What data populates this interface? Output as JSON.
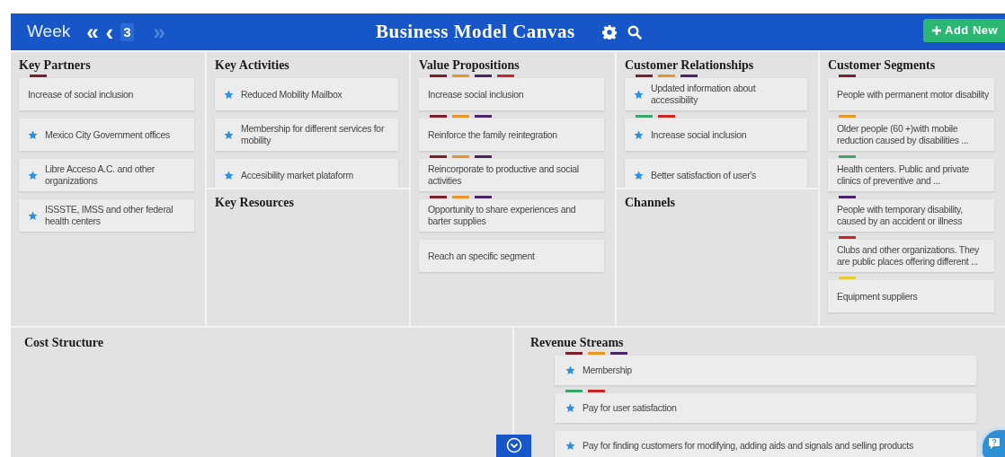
{
  "header": {
    "period_label": "Week",
    "nav": [
      {
        "kind": "first",
        "label": "«",
        "disabled": false
      },
      {
        "kind": "prev",
        "label": "‹",
        "disabled": false
      },
      {
        "kind": "current",
        "label": "3",
        "disabled": false
      },
      {
        "kind": "next",
        "label": "»",
        "disabled": true
      }
    ],
    "title": "Business Model Canvas",
    "add_button": "Add New"
  },
  "top_columns": [
    {
      "blocks": [
        {
          "title": "Key Partners",
          "cards": [
            {
              "text": "Increase of social inclusion",
              "starred": false,
              "tags": [
                {
                  "color": "#7a1f2b"
                }
              ]
            },
            {
              "text": "Mexico City Government offices",
              "starred": true
            },
            {
              "text": "Libre Acceso A.C. and other organizations",
              "starred": true
            },
            {
              "text": "ISSSTE, IMSS and other federal health centers",
              "starred": true
            }
          ]
        }
      ]
    },
    {
      "blocks": [
        {
          "title": "Key Activities",
          "cards": [
            {
              "text": "Reduced Mobility Mailbox",
              "starred": true
            },
            {
              "text": "Membership for different services for mobility",
              "starred": true
            },
            {
              "text": "Accesibility market plataform",
              "starred": true
            }
          ]
        },
        {
          "title": "Key Resources"
        }
      ]
    },
    {
      "blocks": [
        {
          "title": "Value Propositions",
          "cards": [
            {
              "text": "Increase social inclusion",
              "starred": false,
              "tags": [
                {
                  "color": "#7a1f2b"
                },
                {
                  "color": "#e8952a"
                },
                {
                  "color": "#4b2466"
                },
                {
                  "color": "#c62828"
                }
              ]
            },
            {
              "text": "Reinforce the family reintegration",
              "starred": false,
              "tags": [
                {
                  "color": "#7a1f2b"
                },
                {
                  "color": "#e8952a"
                },
                {
                  "color": "#4b2466"
                }
              ]
            },
            {
              "text": "Reincorporate to productive and social activities",
              "starred": false,
              "tags": [
                {
                  "color": "#7a1f2b"
                },
                {
                  "color": "#e8952a"
                },
                {
                  "color": "#4b2466"
                }
              ]
            },
            {
              "text": "Opportunity to share experiences and barter supplies",
              "starred": false,
              "tags": [
                {
                  "color": "#7a1f2b"
                },
                {
                  "color": "#e8952a"
                },
                {
                  "color": "#4b2466"
                }
              ]
            },
            {
              "text": "Reach an specific segment",
              "starred": false
            }
          ]
        }
      ]
    },
    {
      "blocks": [
        {
          "title": "Customer Relationships",
          "cards": [
            {
              "text": "Updated information about accessibility",
              "starred": true,
              "tags": [
                {
                  "color": "#7a1f2b"
                },
                {
                  "color": "#e8952a"
                },
                {
                  "color": "#4b2466"
                }
              ]
            },
            {
              "text": "Increase social inclusion",
              "starred": true,
              "tags": [
                {
                  "color": "#3aa66e"
                },
                {
                  "color": "#c62828"
                }
              ]
            },
            {
              "text": "Better satisfaction of user's",
              "starred": true
            }
          ]
        },
        {
          "title": "Channels"
        }
      ]
    },
    {
      "blocks": [
        {
          "title": "Customer Segments",
          "cards": [
            {
              "text": "People with permanent motor disability",
              "starred": false,
              "tags": [
                {
                  "color": "#7a1f2b"
                }
              ]
            },
            {
              "text": "Older people (60 +)with mobile reduction caused by disabilities ...",
              "starred": false,
              "tags": [
                {
                  "color": "#e8952a"
                }
              ]
            },
            {
              "text": "Health centers. Public and private clinics of preventive and ...",
              "starred": false,
              "tags": [
                {
                  "color": "#3aa66e"
                }
              ]
            },
            {
              "text": "People with temporary disability, caused by an accident or illness",
              "starred": false,
              "tags": [
                {
                  "color": "#4b2466"
                }
              ]
            },
            {
              "text": "Clubs and other organizations. They are public places offering different ...",
              "starred": false,
              "tags": [
                {
                  "color": "#c62828"
                }
              ]
            },
            {
              "text": "Equipment suppliers",
              "starred": false,
              "tags": [
                {
                  "color": "#e8c93a"
                }
              ]
            }
          ]
        }
      ]
    }
  ],
  "bottom_blocks": [
    {
      "title": "Cost Structure"
    },
    {
      "title": "Revenue Streams",
      "cards": [
        {
          "text": "Membership",
          "starred": true,
          "tags": [
            {
              "color": "#7a1f2b"
            },
            {
              "color": "#e8952a"
            },
            {
              "color": "#4b2466"
            }
          ]
        },
        {
          "text": "Pay for user satisfaction",
          "starred": true,
          "tags": [
            {
              "color": "#3aa66e"
            },
            {
              "color": "#c62828"
            }
          ]
        },
        {
          "text": "Pay for finding customers for modifying, adding aids and signals and selling products",
          "starred": true
        }
      ]
    }
  ]
}
